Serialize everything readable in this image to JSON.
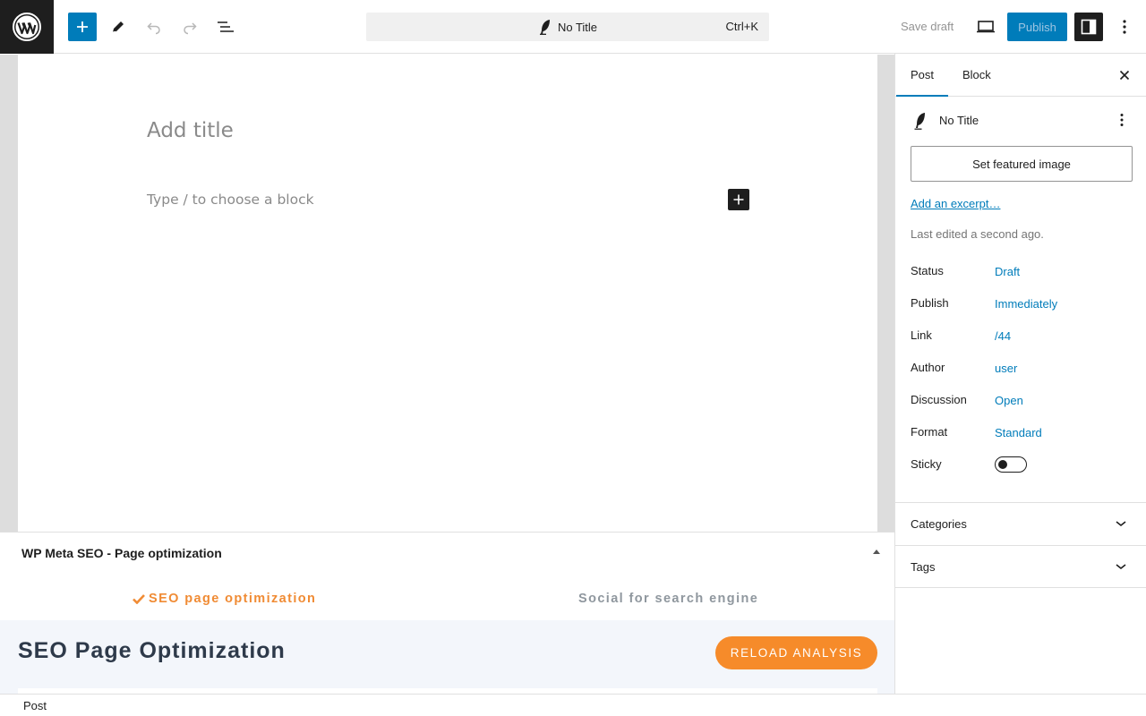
{
  "topbar": {
    "command_title": "No Title",
    "command_shortcut": "Ctrl+K",
    "save_draft": "Save draft",
    "publish": "Publish"
  },
  "editor": {
    "title_placeholder": "Add title",
    "block_placeholder": "Type / to choose a block"
  },
  "metabox": {
    "title": "WP Meta SEO - Page optimization",
    "tab_active": "SEO page optimization",
    "tab_inactive": "Social for search engine",
    "panel_heading": "SEO Page Optimization",
    "reload_button": "RELOAD ANALYSIS"
  },
  "sidebar": {
    "tabs": [
      "Post",
      "Block"
    ],
    "post_title": "No Title",
    "featured_image_button": "Set featured image",
    "excerpt_link": "Add an excerpt…",
    "last_edited": "Last edited a second ago.",
    "rows": [
      {
        "label": "Status",
        "value": "Draft"
      },
      {
        "label": "Publish",
        "value": "Immediately"
      },
      {
        "label": "Link",
        "value": "/44"
      },
      {
        "label": "Author",
        "value": "user"
      },
      {
        "label": "Discussion",
        "value": "Open"
      },
      {
        "label": "Format",
        "value": "Standard"
      }
    ],
    "sticky_label": "Sticky",
    "sticky_on": false,
    "panels": [
      "Categories",
      "Tags"
    ]
  },
  "footer": {
    "breadcrumb": "Post"
  },
  "colors": {
    "accent": "#007cba",
    "seo_orange": "#f68b2a",
    "dark": "#1e1e1e"
  }
}
